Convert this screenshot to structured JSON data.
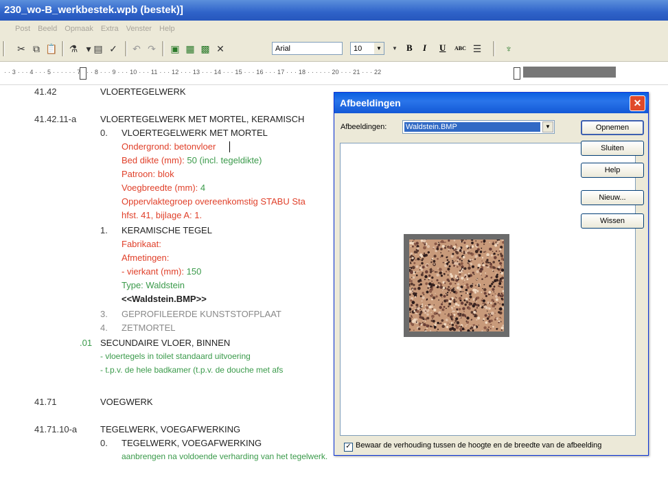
{
  "window": {
    "title": "230_wo-B_werkbestek.wpb (bestek)]"
  },
  "menu": [
    "Post",
    "Beeld",
    "Opmaak",
    "Extra",
    "Venster",
    "Help"
  ],
  "toolbar": {
    "font": "Arial",
    "size": "10",
    "bold": "B",
    "italic": "I",
    "underline": "U",
    "abc": "ABC"
  },
  "ruler": {
    "scale": "· · 3 · · · 4 · · · 5 · · · · · · 7 · · · 8 · · · 9 · · · 10 · · · 11 · · · 12 · · · 13 · · · 14 · · · 15 · · · 16 · · · 17 · · · 18 · · · · · · 20 · · · 21 · · · 22"
  },
  "document": {
    "lines": [
      {
        "num": "41.42",
        "text": "VLOERTEGELWERK"
      },
      {
        "num": "41.42.11-a",
        "text": "VLOERTEGELWERK MET MORTEL, KERAMISCH"
      },
      {
        "num": "0.",
        "text": "VLOERTEGELWERK MET MORTEL"
      },
      {
        "text": "Ondergrond: betonvloer"
      },
      {
        "text_a": "Bed dikte (mm):",
        "text_b": "50 (incl. tegeldikte)"
      },
      {
        "text": "Patroon: blok"
      },
      {
        "text_a": "Voegbreedte (mm):",
        "text_b": "4"
      },
      {
        "text": "Oppervlaktegroep overeenkomstig STABU Sta"
      },
      {
        "text": "hfst. 41, bijlage A: 1."
      },
      {
        "num": "1.",
        "text": "KERAMISCHE TEGEL"
      },
      {
        "text": "Fabrikaat:"
      },
      {
        "text": "Afmetingen:"
      },
      {
        "text_a": "- vierkant (mm):",
        "text_b": "150"
      },
      {
        "text": "Type: Waldstein"
      },
      {
        "text": "<<Waldstein.BMP>>"
      },
      {
        "num": "3.",
        "text": "GEPROFILEERDE KUNSTSTOFPLAAT"
      },
      {
        "num": "4.",
        "text": "ZETMORTEL"
      },
      {
        "num": ".01",
        "text": "SECUNDAIRE VLOER, BINNEN"
      },
      {
        "text": "- vloertegels in toilet standaard uitvoering"
      },
      {
        "text": "- t.p.v. de hele badkamer (t.p.v. de douche met afs"
      },
      {
        "num": "41.71",
        "text": "VOEGWERK"
      },
      {
        "num": "41.71.10-a",
        "text": "TEGELWERK, VOEGAFWERKING"
      },
      {
        "num": "0.",
        "text": "TEGELWERK, VOEGAFWERKING"
      },
      {
        "text": "aanbrengen na voldoende verharding van het tegelwerk."
      }
    ]
  },
  "dialog": {
    "title": "Afbeeldingen",
    "label": "Afbeeldingen:",
    "selected": "Waldstein.BMP",
    "buttons": [
      "Opnemen",
      "Sluiten",
      "Help",
      "Nieuw...",
      "Wissen"
    ],
    "checkbox": {
      "checked": true,
      "label": "Bewaar de verhouding tussen de hoogte en de breedte van de afbeelding"
    }
  },
  "colors": {
    "title": "#2f63c9",
    "red_text": "#e0402a",
    "green_text": "#3a9a4a"
  }
}
